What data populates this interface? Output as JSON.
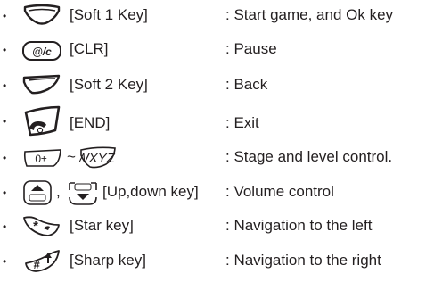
{
  "bullet": "•",
  "rows": [
    {
      "icon": "soft-1-key-icon",
      "label": "[Soft 1 Key]",
      "description": ": Start game, and Ok key"
    },
    {
      "icon": "clr-key-icon",
      "icon_text": "@/c",
      "label": "[CLR]",
      "description": ": Pause"
    },
    {
      "icon": "soft-2-key-icon",
      "label": "[Soft 2 Key]",
      "description": ": Back"
    },
    {
      "icon": "end-key-icon",
      "label": "[END]",
      "description": ": Exit"
    },
    {
      "icon": "number-keys-icon",
      "range_from": "0±",
      "range_sep": "~",
      "range_to": "9WXYZ",
      "label": "",
      "description": ": Stage and level control."
    },
    {
      "icon": "up-down-key-icon",
      "separator": ",",
      "label": "[Up,down key]",
      "description": ": Volume control"
    },
    {
      "icon": "star-key-icon",
      "icon_text": "*",
      "label": "[Star key]",
      "description": ": Navigation to the left"
    },
    {
      "icon": "sharp-key-icon",
      "icon_text": "#",
      "label": "[Sharp key]",
      "description": ": Navigation to the right"
    }
  ]
}
